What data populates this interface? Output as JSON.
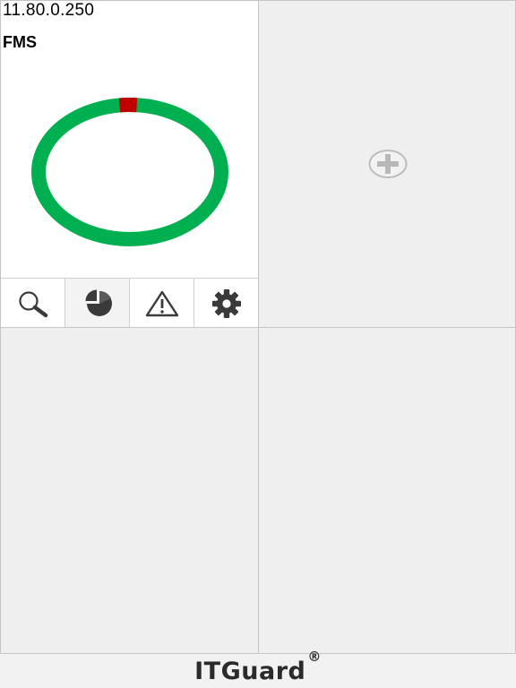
{
  "widgets": [
    {
      "ip": "11.80.0.250",
      "name": "FMS",
      "status_chart": {
        "slices": [
          {
            "status": "ok",
            "fraction": 0.97,
            "color": "#00b050"
          },
          {
            "status": "critical",
            "fraction": 0.03,
            "color": "#c00000"
          }
        ]
      },
      "toolbar": [
        "search-icon",
        "pie-chart-icon",
        "warning-icon",
        "gear-icon"
      ]
    }
  ],
  "add_widget_icon": "plus-circle-icon",
  "brand": {
    "name": "ITGuard",
    "registered": "®"
  },
  "colors": {
    "ok": "#00b050",
    "critical": "#c00000",
    "icon": "#3a3a3a"
  }
}
